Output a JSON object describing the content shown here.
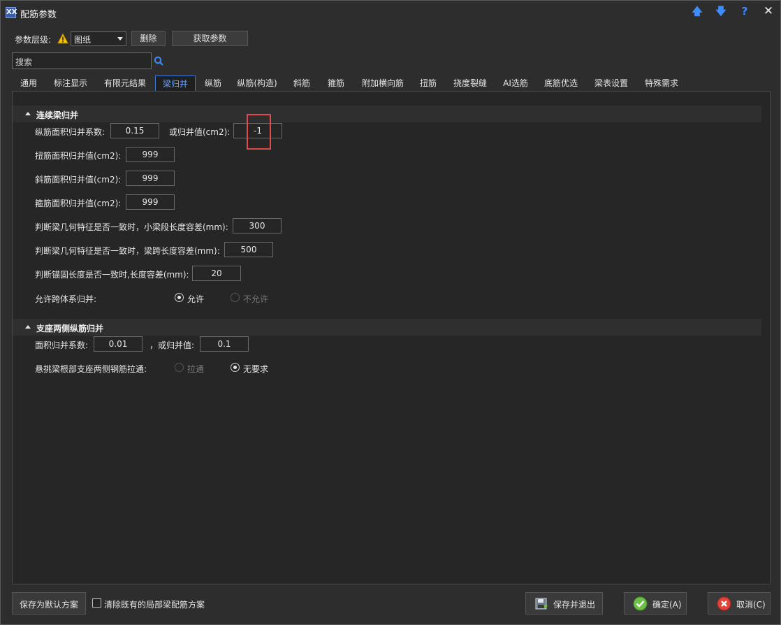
{
  "window": {
    "title": "配筋参数",
    "icon_glyph": "XX"
  },
  "titlebar_buttons": [
    {
      "name": "move-up-icon",
      "glyph": "🡅"
    },
    {
      "name": "move-down-icon",
      "glyph": "🡇"
    },
    {
      "name": "help-icon",
      "glyph": "?"
    },
    {
      "name": "close-icon",
      "glyph": "✕"
    }
  ],
  "toolbar": {
    "level_label": "参数层级:",
    "level_value": "图纸",
    "delete_label": "删除",
    "fetch_label": "获取参数"
  },
  "search": {
    "placeholder": "搜索"
  },
  "tabs": [
    {
      "label": "通用"
    },
    {
      "label": "标注显示"
    },
    {
      "label": "有限元结果"
    },
    {
      "label": "梁归并"
    },
    {
      "label": "纵筋"
    },
    {
      "label": "纵筋(构造)"
    },
    {
      "label": "斜筋"
    },
    {
      "label": "箍筋"
    },
    {
      "label": "附加横向筋"
    },
    {
      "label": "扭筋"
    },
    {
      "label": "挠度裂缝"
    },
    {
      "label": "AI选筋"
    },
    {
      "label": "底筋优选"
    },
    {
      "label": "梁表设置"
    },
    {
      "label": "特殊需求"
    }
  ],
  "active_tab": "梁归并",
  "section1": {
    "title": "连续梁归并",
    "long_coef_label": "纵筋面积归并系数:",
    "long_coef_value": "0.15",
    "or_merge_label": "或归并值(cm2):",
    "or_merge_value": "-1",
    "torsion_label": "扭筋面积归并值(cm2):",
    "torsion_value": "999",
    "diag_label": "斜筋面积归并值(cm2):",
    "diag_value": "999",
    "stirrup_label": "箍筋面积归并值(cm2):",
    "stirrup_value": "999",
    "small_seg_label": "判断梁几何特征是否一致时，小梁段长度容差(mm):",
    "small_seg_value": "300",
    "span_label": "判断梁几何特征是否一致时，梁跨长度容差(mm):",
    "span_value": "500",
    "anchor_label": "判断锚固长度是否一致时,长度容差(mm):",
    "anchor_value": "20",
    "cross_label": "允许跨体系归并:",
    "cross_options": [
      "允许",
      "不允许"
    ],
    "cross_selected": "允许"
  },
  "section2": {
    "title": "支座两侧纵筋归并",
    "area_coef_label": "面积归并系数:",
    "area_coef_value": "0.01",
    "or_value_label": "，或归并值:",
    "or_value_value": "0.1",
    "cantilever_label": "悬挑梁根部支座两侧钢筋拉通:",
    "cantilever_options": [
      "拉通",
      "无要求"
    ],
    "cantilever_selected": "无要求"
  },
  "footer": {
    "save_default_label": "保存为默认方案",
    "clear_local_label": "清除既有的局部梁配筋方案",
    "save_exit_label": "保存并退出",
    "ok_label": "确定(A)",
    "cancel_label": "取消(C)"
  },
  "colors": {
    "accent": "#3f78d8",
    "highlight": "#e04a4a",
    "ok_icon": "#6cc04a",
    "cancel_icon": "#e2443a"
  }
}
